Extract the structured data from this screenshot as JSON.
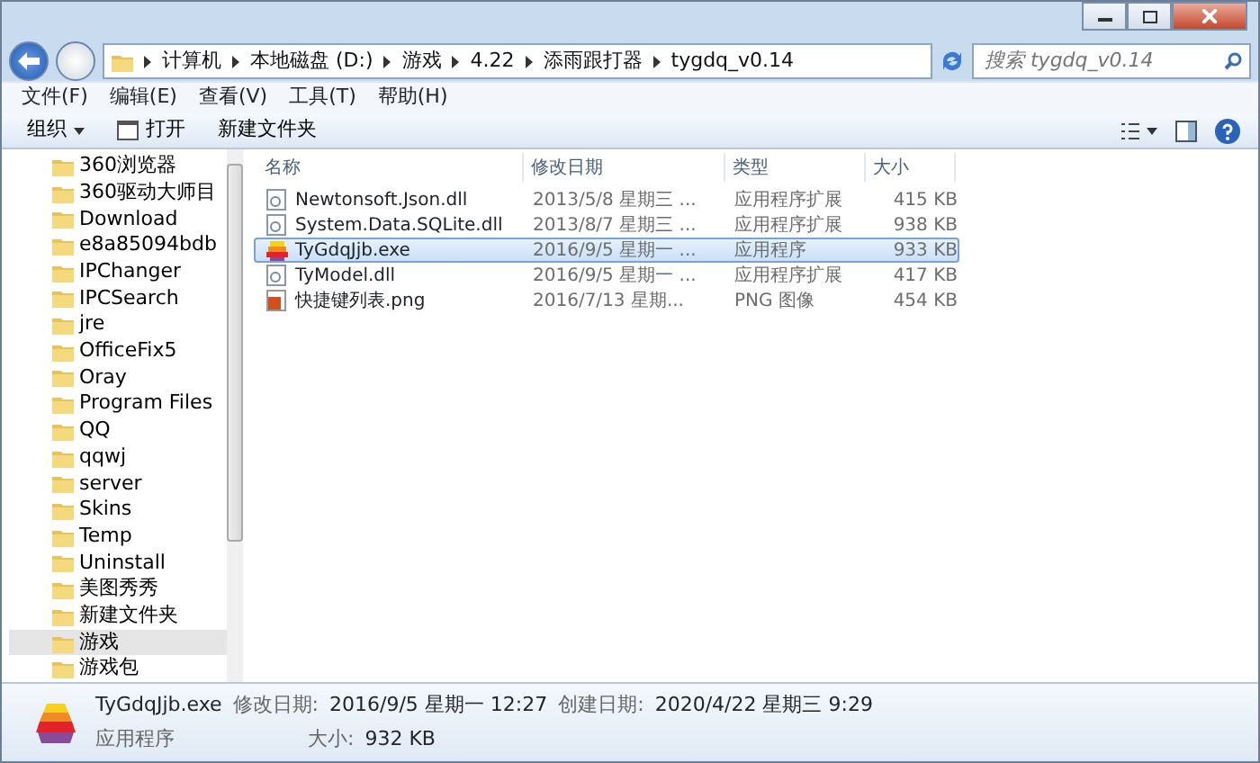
{
  "address_bar": {
    "crumbs": [
      "计算机",
      "本地磁盘 (D:)",
      "游戏",
      "4.22",
      "添雨跟打器",
      "tygdq_v0.14"
    ]
  },
  "search": {
    "placeholder": "搜索 tygdq_v0.14"
  },
  "menu": [
    "文件(F)",
    "编辑(E)",
    "查看(V)",
    "工具(T)",
    "帮助(H)"
  ],
  "toolbar": [
    {
      "kind": "dropdown",
      "label": "组织"
    },
    {
      "kind": "open",
      "label": "打开"
    },
    {
      "kind": "plain",
      "label": "新建文件夹"
    }
  ],
  "sidebar": {
    "items": [
      {
        "label": "360浏览器",
        "selected": false
      },
      {
        "label": "360驱动大师目",
        "selected": false
      },
      {
        "label": "Download",
        "selected": false
      },
      {
        "label": "e8a85094bdb",
        "selected": false
      },
      {
        "label": "IPChanger",
        "selected": false
      },
      {
        "label": "IPCSearch",
        "selected": false
      },
      {
        "label": "jre",
        "selected": false
      },
      {
        "label": "OfficeFix5",
        "selected": false
      },
      {
        "label": "Oray",
        "selected": false
      },
      {
        "label": "Program Files",
        "selected": false
      },
      {
        "label": "QQ",
        "selected": false
      },
      {
        "label": "qqwj",
        "selected": false
      },
      {
        "label": "server",
        "selected": false
      },
      {
        "label": "Skins",
        "selected": false
      },
      {
        "label": "Temp",
        "selected": false
      },
      {
        "label": "Uninstall",
        "selected": false
      },
      {
        "label": "美图秀秀",
        "selected": false
      },
      {
        "label": "新建文件夹",
        "selected": false
      },
      {
        "label": "游戏",
        "selected": true
      },
      {
        "label": "游戏包",
        "selected": false
      }
    ]
  },
  "table": {
    "columns": [
      "名称",
      "修改日期",
      "类型",
      "大小"
    ],
    "rows": [
      {
        "kind": "dll",
        "name": "Newtonsoft.Json.dll",
        "date": "2013/5/8 星期三 ...",
        "type": "应用程序扩展",
        "size": "415 KB",
        "selected": false
      },
      {
        "kind": "dll",
        "name": "System.Data.SQLite.dll",
        "date": "2013/8/7 星期三 ...",
        "type": "应用程序扩展",
        "size": "938 KB",
        "selected": false
      },
      {
        "kind": "exe",
        "name": "TyGdqJjb.exe",
        "date": "2016/9/5 星期一 ...",
        "type": "应用程序",
        "size": "933 KB",
        "selected": true
      },
      {
        "kind": "dll",
        "name": "TyModel.dll",
        "date": "2016/9/5 星期一 ...",
        "type": "应用程序扩展",
        "size": "417 KB",
        "selected": false
      },
      {
        "kind": "png",
        "name": "快捷键列表.png",
        "date": "2016/7/13 星期...",
        "type": "PNG 图像",
        "size": "454 KB",
        "selected": false
      }
    ]
  },
  "details": {
    "name": "TyGdqJjb.exe",
    "type": "应用程序",
    "modified_label": "修改日期:",
    "modified": "2016/9/5 星期一 12:27",
    "created_label": "创建日期:",
    "created": "2020/4/22 星期三 9:29",
    "size_label": "大小:",
    "size": "932 KB"
  }
}
